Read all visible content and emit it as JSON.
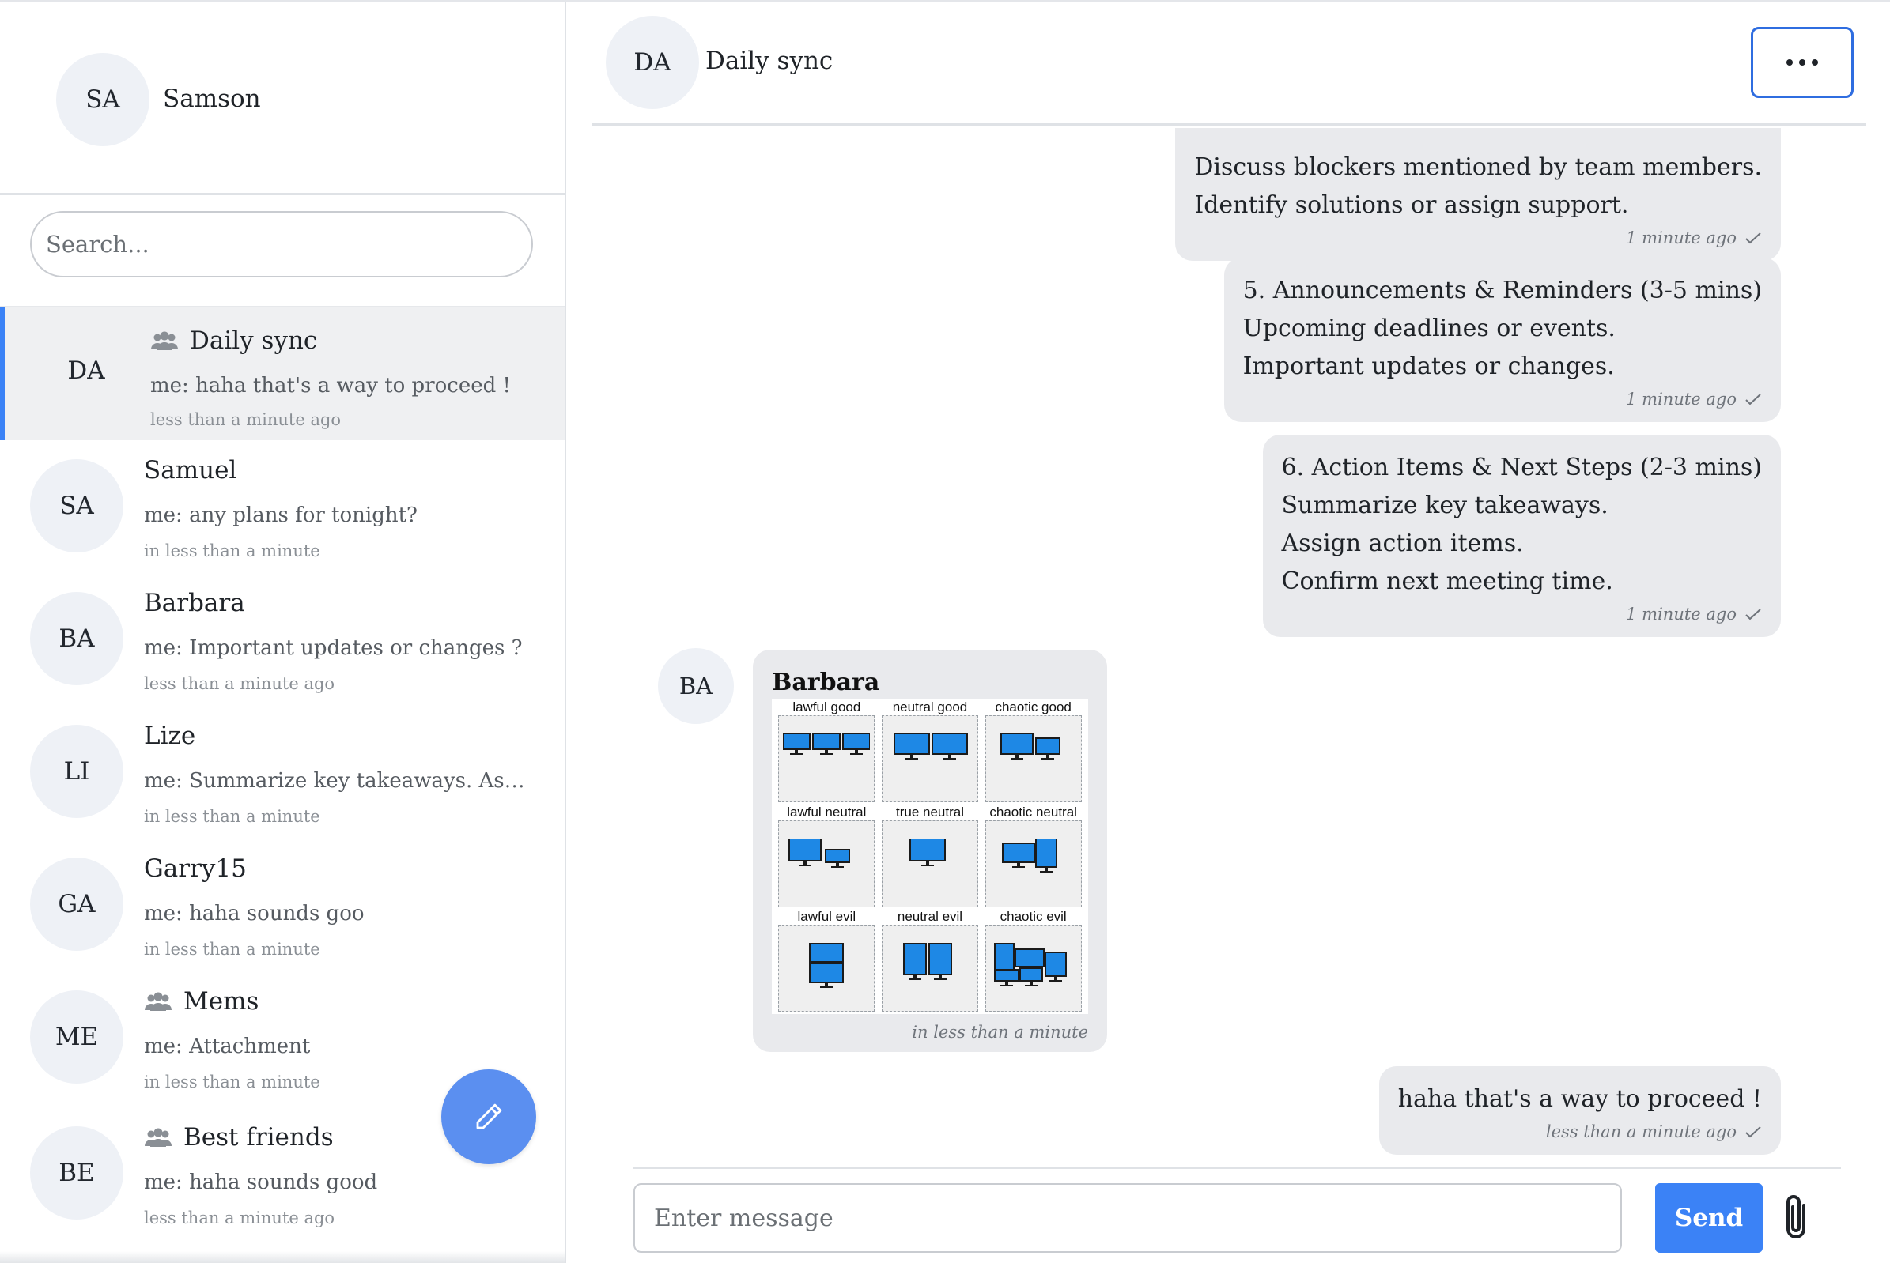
{
  "current_user": {
    "initials": "SA",
    "name": "Samson"
  },
  "search": {
    "placeholder": "Search..."
  },
  "conversations": [
    {
      "initials": "DA",
      "name": "Daily sync",
      "group": true,
      "preview": "me: haha that's a way to proceed !",
      "time": "less than a minute ago",
      "active": true
    },
    {
      "initials": "SA",
      "name": "Samuel",
      "group": false,
      "preview": "me: any plans for tonight?",
      "time": "in less than a minute"
    },
    {
      "initials": "BA",
      "name": "Barbara",
      "group": false,
      "preview": "me: Important updates or changes ?",
      "time": "less than a minute ago"
    },
    {
      "initials": "LI",
      "name": "Lize",
      "group": false,
      "preview": "me: Summarize key takeaways. Assign action items. Confirm next meeting time.",
      "time": "in less than a minute"
    },
    {
      "initials": "GA",
      "name": "Garry15",
      "group": false,
      "preview": "me: haha sounds goo",
      "time": "in less than a minute"
    },
    {
      "initials": "ME",
      "name": "Mems",
      "group": true,
      "preview": "me: Attachment",
      "time": "in less than a minute"
    },
    {
      "initials": "BE",
      "name": "Best friends",
      "group": true,
      "preview": "me: haha sounds good",
      "time": "less than a minute ago"
    }
  ],
  "chat": {
    "initials": "DA",
    "title": "Daily sync",
    "messages": [
      {
        "sender": "me",
        "lines": [
          "Discuss blockers mentioned by team members.",
          "Identify solutions or assign support."
        ],
        "time": "1 minute ago"
      },
      {
        "sender": "me",
        "lines": [
          "5. Announcements & Reminders (3-5 mins)",
          "Upcoming deadlines or events.",
          "Important updates or changes."
        ],
        "time": "1 minute ago"
      },
      {
        "sender": "me",
        "lines": [
          "6. Action Items & Next Steps (2-3 mins)",
          "Summarize key takeaways.",
          "Assign action items.",
          "Confirm next meeting time."
        ],
        "time": "1 minute ago"
      },
      {
        "sender": "Barbara",
        "initials": "BA",
        "name": "Barbara",
        "image_labels": [
          "lawful good",
          "neutral good",
          "chaotic good",
          "lawful neutral",
          "true neutral",
          "chaotic neutral",
          "lawful evil",
          "neutral evil",
          "chaotic evil"
        ],
        "time": "in less than a minute"
      },
      {
        "sender": "me",
        "lines": [
          "haha that's a way to proceed !"
        ],
        "time": "less than a minute ago"
      }
    ]
  },
  "composer": {
    "placeholder": "Enter message",
    "send_label": "Send"
  },
  "colors": {
    "accent": "#3b82f6",
    "compose_button": "#5b8ff0",
    "bubble": "#e9eaed",
    "avatar_bg": "#eef1f6"
  }
}
